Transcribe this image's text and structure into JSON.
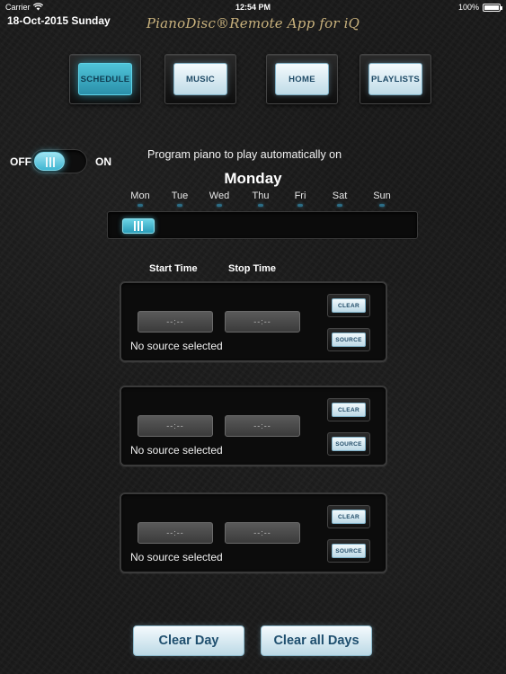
{
  "status_bar": {
    "carrier": "Carrier",
    "time": "12:54 PM",
    "battery": "100%"
  },
  "header": {
    "date": "18-Oct-2015 Sunday",
    "app_title": "PianoDisc®Remote App for iQ"
  },
  "nav": {
    "items": [
      {
        "label": "SCHEDULE",
        "active": true
      },
      {
        "label": "MUSIC",
        "active": false
      },
      {
        "label": "HOME",
        "active": false
      },
      {
        "label": "PLAYLISTS",
        "active": false
      }
    ]
  },
  "toggle": {
    "off_label": "OFF",
    "on_label": "ON",
    "state": "off"
  },
  "program_text": "Program piano to play automatically on",
  "selected_day": "Monday",
  "weekdays": [
    "Mon",
    "Tue",
    "Wed",
    "Thu",
    "Fri",
    "Sat",
    "Sun"
  ],
  "columns": {
    "start": "Start Time",
    "stop": "Stop Time"
  },
  "slots": [
    {
      "start": "--:--",
      "stop": "--:--",
      "source": "No source selected",
      "clear_label": "CLEAR",
      "source_label": "SOURCE"
    },
    {
      "start": "--:--",
      "stop": "--:--",
      "source": "No source selected",
      "clear_label": "CLEAR",
      "source_label": "SOURCE"
    },
    {
      "start": "--:--",
      "stop": "--:--",
      "source": "No source selected",
      "clear_label": "CLEAR",
      "source_label": "SOURCE"
    }
  ],
  "actions": {
    "clear_day": "Clear Day",
    "clear_all_days": "Clear all Days"
  },
  "colors": {
    "accent": "#3fb6d2",
    "title_gold": "#c9b27d",
    "button_text": "#1e4e6e"
  }
}
